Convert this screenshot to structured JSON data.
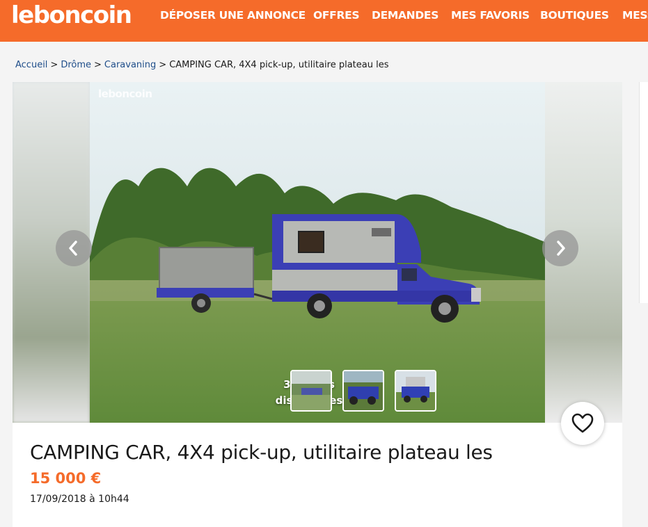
{
  "header": {
    "logo": "leboncoin",
    "nav": [
      {
        "label": "DÉPOSER UNE ANNONCE"
      },
      {
        "label": "OFFRES"
      },
      {
        "label": "DEMANDES"
      },
      {
        "label": "MES FAVORIS"
      },
      {
        "label": "BOUTIQUES"
      },
      {
        "label": "MESS"
      }
    ],
    "brand_color": "#f56b2a"
  },
  "breadcrumb": {
    "items": [
      "Accueil",
      "Drôme",
      "Caravaning"
    ],
    "separator": ">",
    "current": "CAMPING CAR, 4X4 pick-up, utilitaire plateau les"
  },
  "gallery": {
    "watermark": "leboncoin",
    "photo_count_line1": "3 photos",
    "photo_count_line2": "disponibles",
    "prev_icon": "chevron-left-icon",
    "next_icon": "chevron-right-icon"
  },
  "listing": {
    "title": "CAMPING CAR, 4X4 pick-up, utilitaire plateau les",
    "price": "15 000 €",
    "date": "17/09/2018 à 10h44",
    "favorite_icon": "heart-icon",
    "price_color": "#f56b2a"
  }
}
